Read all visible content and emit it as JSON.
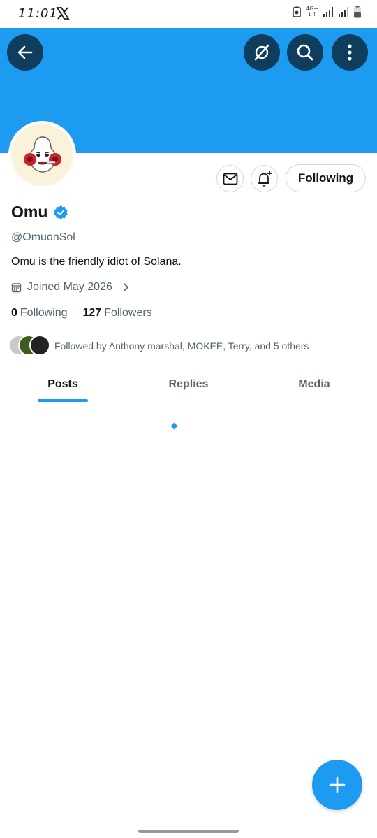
{
  "status_bar": {
    "time": "11:01",
    "network_label": "4G+"
  },
  "profile": {
    "display_name": "Omu",
    "handle": "@OmuonSol",
    "bio": "Omu is the friendly idiot of Solana.",
    "joined": "Joined May 2026",
    "following_count": "0",
    "following_label": "Following",
    "followers_count": "127",
    "followers_label": "Followers",
    "followed_by": "Followed by Anthony marshal, MOKEE, Terry, and 5 others"
  },
  "actions": {
    "follow_button_label": "Following"
  },
  "tabs": [
    {
      "label": "Posts",
      "active": true
    },
    {
      "label": "Replies",
      "active": false
    },
    {
      "label": "Media",
      "active": false
    }
  ],
  "colors": {
    "accent": "#1d9bf0",
    "banner": "#1d9bf0",
    "header_button": "#0f3d5e",
    "text_primary": "#0f1419",
    "text_secondary": "#536471"
  },
  "icons": {
    "back": "arrow-left-icon",
    "grok": "grok-icon",
    "search": "search-icon",
    "more": "more-vertical-icon",
    "message": "envelope-icon",
    "notify": "bell-plus-icon",
    "verified": "verified-badge-icon",
    "calendar": "calendar-icon",
    "chevron": "chevron-right-icon",
    "compose": "plus-icon"
  }
}
